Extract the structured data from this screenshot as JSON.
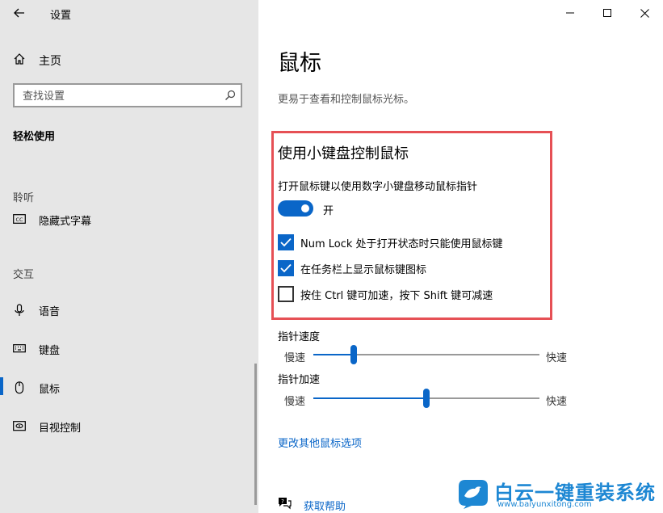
{
  "window": {
    "title": "设置",
    "controls": [
      "minimize-icon",
      "maximize-icon",
      "close-icon"
    ]
  },
  "sidebar": {
    "home_label": "主页",
    "search_placeholder": "查找设置",
    "category": "轻松使用",
    "sections": {
      "hearing": "聆听",
      "interaction": "交互"
    },
    "items": [
      {
        "label": "隐藏式字幕",
        "icon": "closed-caption-icon"
      },
      {
        "label": "语音",
        "icon": "microphone-icon"
      },
      {
        "label": "键盘",
        "icon": "keyboard-icon"
      },
      {
        "label": "鼠标",
        "icon": "mouse-icon",
        "active": true
      },
      {
        "label": "目视控制",
        "icon": "eye-control-icon"
      }
    ]
  },
  "main": {
    "title": "鼠标",
    "description": "更易于查看和控制鼠标光标。",
    "keypad_group": {
      "title": "使用小键盘控制鼠标",
      "toggle_description": "打开鼠标键以使用数字小键盘移动鼠标指针",
      "toggle_state": "开",
      "toggle_on": true,
      "checkboxes": [
        {
          "label": "Num Lock 处于打开状态时只能使用鼠标键",
          "checked": true
        },
        {
          "label": "在任务栏上显示鼠标键图标",
          "checked": true
        },
        {
          "label": "按住 Ctrl 键可加速，按下 Shift 键可减速",
          "checked": false
        }
      ]
    },
    "sliders": [
      {
        "title": "指针速度",
        "min_label": "慢速",
        "max_label": "快速",
        "value_fraction": 0.18
      },
      {
        "title": "指针加速",
        "min_label": "慢速",
        "max_label": "快速",
        "value_fraction": 0.5
      }
    ],
    "more_options_link": "更改其他鼠标选项",
    "help_link": "获取帮助"
  },
  "watermark": {
    "text": "白云一键重装系统",
    "url": "www.baiyunxitong.com"
  },
  "colors": {
    "accent": "#0a66c8",
    "highlight_border": "#e65055",
    "sidebar_bg": "#e6e6e6",
    "watermark": "#1d87d3"
  }
}
